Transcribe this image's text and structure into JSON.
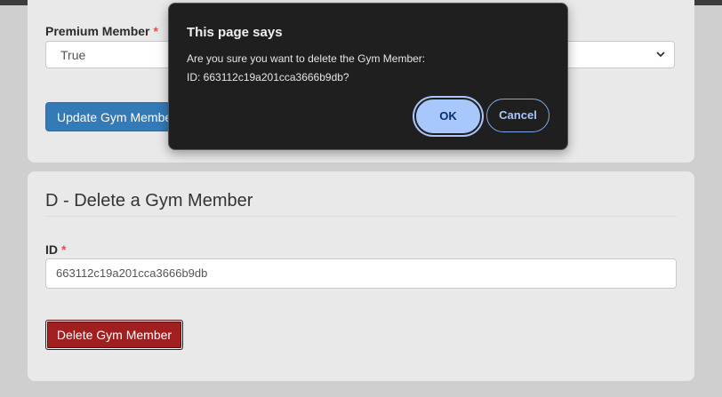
{
  "update_section": {
    "premium_label": "Premium Member",
    "required_mark": "*",
    "premium_value": "True",
    "update_button": "Update Gym Member"
  },
  "delete_section": {
    "title": "D - Delete a Gym Member",
    "id_label": "ID",
    "required_mark": "*",
    "id_value": "663112c19a201cca3666b9db",
    "delete_button": "Delete Gym Member"
  },
  "dialog": {
    "title": "This page says",
    "message_line1": "Are you sure you want to delete the Gym Member:",
    "message_line2": "ID: 663112c19a201cca3666b9db?",
    "ok_label": "OK",
    "cancel_label": "Cancel"
  },
  "colors": {
    "update_button_bg": "#337ab7",
    "delete_button_bg": "#a11f1f",
    "dialog_bg": "#1f1f1f",
    "dialog_ok_bg": "#a8c7fa",
    "required_mark": "#d9534f"
  },
  "icons": {
    "select_arrow": "chevron-down-icon"
  }
}
